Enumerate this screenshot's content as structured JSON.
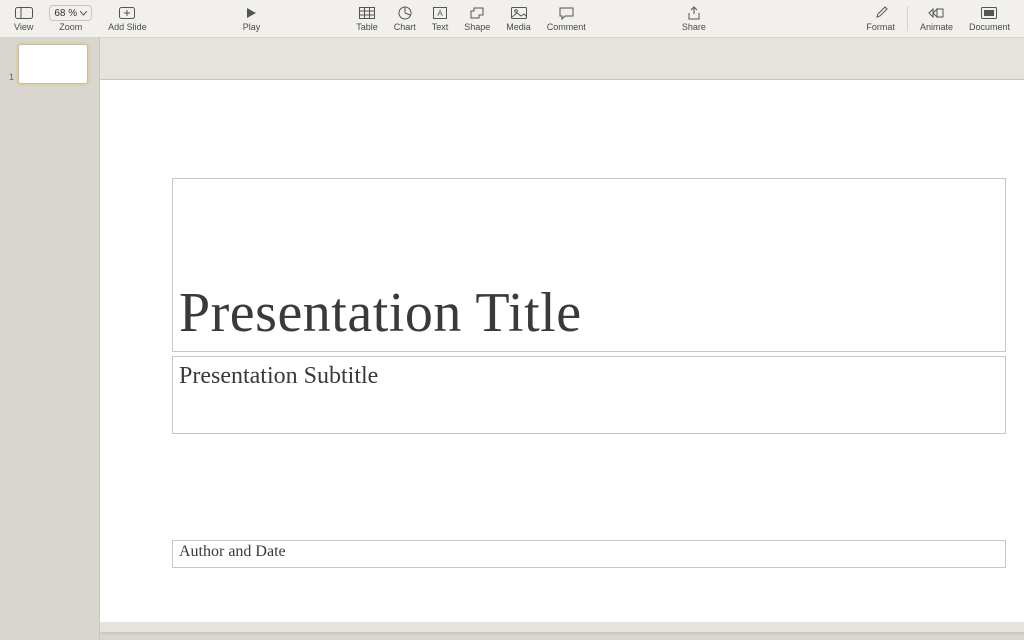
{
  "toolbar": {
    "view": "View",
    "zoom_value": "68 %",
    "zoom": "Zoom",
    "add_slide": "Add Slide",
    "play": "Play",
    "table": "Table",
    "chart": "Chart",
    "text": "Text",
    "shape": "Shape",
    "media": "Media",
    "comment": "Comment",
    "share": "Share",
    "format": "Format",
    "animate": "Animate",
    "document": "Document"
  },
  "slides": {
    "thumb1_number": "1"
  },
  "slide_content": {
    "title": "Presentation Title",
    "subtitle": "Presentation Subtitle",
    "author": "Author and Date"
  }
}
